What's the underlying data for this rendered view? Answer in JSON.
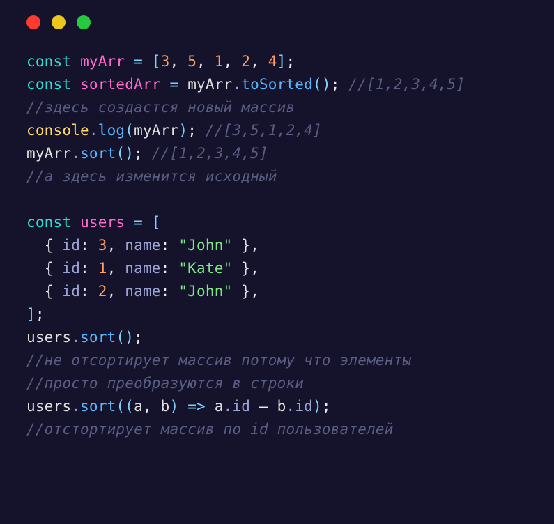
{
  "code": {
    "l1": {
      "kw": "const ",
      "var": "myArr ",
      "eq": "= [",
      "n1": "3",
      "c1": ", ",
      "n2": "5",
      "c2": ", ",
      "n3": "1",
      "c3": ", ",
      "n4": "2",
      "c4": ", ",
      "n5": "4",
      "close": "]",
      "semi": ";"
    },
    "l2": {
      "kw": "const ",
      "var": "sortedArr ",
      "eq": "= ",
      "ref": "myArr",
      "dot": ".",
      "method": "toSorted",
      "paren": "()",
      "semi": "; ",
      "comment": "//[1,2,3,4,5]"
    },
    "l3": {
      "comment": "//здесь создастся новый массив"
    },
    "l4": {
      "console": "console",
      "dot": ".",
      "method": "log",
      "op": "(",
      "ref": "myArr",
      "cl": ")",
      "semi": "; ",
      "comment": "//[3,5,1,2,4]"
    },
    "l5": {
      "ref": "myArr",
      "dot": ".",
      "method": "sort",
      "paren": "()",
      "semi": "; ",
      "comment": "//[1,2,3,4,5]"
    },
    "l6": {
      "comment": "//а здесь изменится исходный"
    },
    "l7": {
      "blank": " "
    },
    "l8": {
      "kw": "const ",
      "var": "users ",
      "eq": "= ["
    },
    "l9": {
      "indent": "  ",
      "ob": "{ ",
      "p1": "id",
      "c1": ": ",
      "n": "3",
      "c2": ", ",
      "p2": "name",
      "c3": ": ",
      "str": "\"John\"",
      "cb": " }",
      "comma": ","
    },
    "l10": {
      "indent": "  ",
      "ob": "{ ",
      "p1": "id",
      "c1": ": ",
      "n": "1",
      "c2": ", ",
      "p2": "name",
      "c3": ": ",
      "str": "\"Kate\"",
      "cb": " }",
      "comma": ","
    },
    "l11": {
      "indent": "  ",
      "ob": "{ ",
      "p1": "id",
      "c1": ": ",
      "n": "2",
      "c2": ", ",
      "p2": "name",
      "c3": ": ",
      "str": "\"John\"",
      "cb": " }",
      "comma": ","
    },
    "l12": {
      "close": "]",
      "semi": ";"
    },
    "l13": {
      "ref": "users",
      "dot": ".",
      "method": "sort",
      "paren": "()",
      "semi": ";"
    },
    "l14": {
      "comment": "//не отсортирует массив потому что элементы"
    },
    "l15": {
      "comment": "//просто преобразуются в строки"
    },
    "l16": {
      "ref": "users",
      "dot": ".",
      "method": "sort",
      "op": "((",
      "a": "a",
      "c1": ", ",
      "b": "b",
      "cp": ") ",
      "arrow": "=> ",
      "a2": "a",
      "d1": ".",
      "id1": "id",
      "minus": " – ",
      "b2": "b",
      "d2": ".",
      "id2": "id",
      "cl": ")",
      "semi": ";"
    },
    "l17": {
      "comment": "//отстортирует массив по id пользователей"
    }
  }
}
